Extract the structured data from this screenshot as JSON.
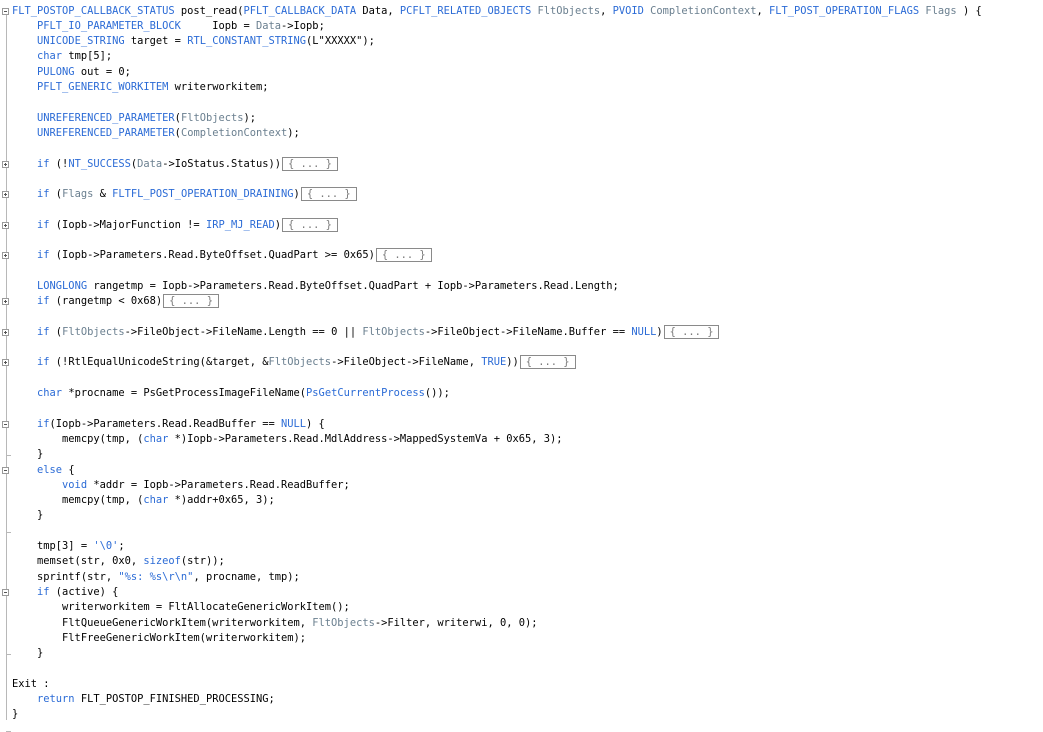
{
  "fold_marker": "{ ... }",
  "lines": [
    [
      [
        "k",
        "FLT_POSTOP_CALLBACK_STATUS"
      ],
      [
        "v",
        " post_read("
      ],
      [
        "k",
        "PFLT_CALLBACK_DATA"
      ],
      [
        "v",
        " Data, "
      ],
      [
        "k",
        "PCFLT_RELATED_OBJECTS"
      ],
      [
        "m",
        " FltObjects"
      ],
      [
        "v",
        ", "
      ],
      [
        "k",
        "PVOID"
      ],
      [
        "m",
        " CompletionContext"
      ],
      [
        "v",
        ", "
      ],
      [
        "k",
        "FLT_POST_OPERATION_FLAGS"
      ],
      [
        "m",
        " Flags"
      ],
      [
        "v",
        " ) {"
      ]
    ],
    [
      [
        "v",
        "    "
      ],
      [
        "k",
        "PFLT_IO_PARAMETER_BLOCK"
      ],
      [
        "v",
        "     Iopb = "
      ],
      [
        "m",
        "Data"
      ],
      [
        "v",
        "->Iopb;"
      ]
    ],
    [
      [
        "v",
        "    "
      ],
      [
        "k",
        "UNICODE_STRING"
      ],
      [
        "v",
        " target = "
      ],
      [
        "k",
        "RTL_CONSTANT_STRING"
      ],
      [
        "v",
        "(L\"XXXXX\");"
      ]
    ],
    [
      [
        "v",
        "    "
      ],
      [
        "k",
        "char"
      ],
      [
        "v",
        " tmp[5];"
      ]
    ],
    [
      [
        "v",
        "    "
      ],
      [
        "k",
        "PULONG"
      ],
      [
        "v",
        " out = 0;"
      ]
    ],
    [
      [
        "v",
        "    "
      ],
      [
        "k",
        "PFLT_GENERIC_WORKITEM"
      ],
      [
        "v",
        " writerworkitem;"
      ]
    ],
    [],
    [
      [
        "v",
        "    "
      ],
      [
        "k",
        "UNREFERENCED_PARAMETER"
      ],
      [
        "v",
        "("
      ],
      [
        "m",
        "FltObjects"
      ],
      [
        "v",
        ");"
      ]
    ],
    [
      [
        "v",
        "    "
      ],
      [
        "k",
        "UNREFERENCED_PARAMETER"
      ],
      [
        "v",
        "("
      ],
      [
        "m",
        "CompletionContext"
      ],
      [
        "v",
        ");"
      ]
    ],
    [],
    [
      [
        "v",
        "    "
      ],
      [
        "k",
        "if"
      ],
      [
        "v",
        " (!"
      ],
      [
        "k",
        "NT_SUCCESS"
      ],
      [
        "v",
        "("
      ],
      [
        "m",
        "Data"
      ],
      [
        "v",
        "->IoStatus.Status))"
      ],
      [
        "f",
        ""
      ]
    ],
    [],
    [
      [
        "v",
        "    "
      ],
      [
        "k",
        "if"
      ],
      [
        "v",
        " ("
      ],
      [
        "m",
        "Flags"
      ],
      [
        "v",
        " & "
      ],
      [
        "k",
        "FLTFL_POST_OPERATION_DRAINING"
      ],
      [
        "v",
        ")"
      ],
      [
        "f",
        ""
      ]
    ],
    [],
    [
      [
        "v",
        "    "
      ],
      [
        "k",
        "if"
      ],
      [
        "v",
        " (Iopb->MajorFunction != "
      ],
      [
        "k",
        "IRP_MJ_READ"
      ],
      [
        "v",
        ")"
      ],
      [
        "f",
        ""
      ]
    ],
    [],
    [
      [
        "v",
        "    "
      ],
      [
        "k",
        "if"
      ],
      [
        "v",
        " (Iopb->Parameters.Read.ByteOffset.QuadPart >= 0x65)"
      ],
      [
        "f",
        ""
      ]
    ],
    [],
    [
      [
        "v",
        "    "
      ],
      [
        "k",
        "LONGLONG"
      ],
      [
        "v",
        " rangetmp = Iopb->Parameters.Read.ByteOffset.QuadPart + Iopb->Parameters.Read.Length;"
      ]
    ],
    [
      [
        "v",
        "    "
      ],
      [
        "k",
        "if"
      ],
      [
        "v",
        " (rangetmp < 0x68)"
      ],
      [
        "f",
        ""
      ]
    ],
    [],
    [
      [
        "v",
        "    "
      ],
      [
        "k",
        "if"
      ],
      [
        "v",
        " ("
      ],
      [
        "m",
        "FltObjects"
      ],
      [
        "v",
        "->FileObject->FileName.Length == 0 || "
      ],
      [
        "m",
        "FltObjects"
      ],
      [
        "v",
        "->FileObject->FileName.Buffer == "
      ],
      [
        "k",
        "NULL"
      ],
      [
        "v",
        ")"
      ],
      [
        "f",
        ""
      ]
    ],
    [],
    [
      [
        "v",
        "    "
      ],
      [
        "k",
        "if"
      ],
      [
        "v",
        " (!RtlEqualUnicodeString(&target, &"
      ],
      [
        "m",
        "FltObjects"
      ],
      [
        "v",
        "->FileObject->FileName, "
      ],
      [
        "k",
        "TRUE"
      ],
      [
        "v",
        "))"
      ],
      [
        "f",
        ""
      ]
    ],
    [],
    [
      [
        "v",
        "    "
      ],
      [
        "k",
        "char"
      ],
      [
        "v",
        " *procname = PsGetProcessImageFileName("
      ],
      [
        "k",
        "PsGetCurrentProcess"
      ],
      [
        "v",
        "());"
      ]
    ],
    [],
    [
      [
        "v",
        "    "
      ],
      [
        "k",
        "if"
      ],
      [
        "v",
        "(Iopb->Parameters.Read.ReadBuffer == "
      ],
      [
        "k",
        "NULL"
      ],
      [
        "v",
        ") {"
      ]
    ],
    [
      [
        "v",
        "        memcpy(tmp, ("
      ],
      [
        "k",
        "char"
      ],
      [
        "v",
        " *)Iopb->Parameters.Read.MdlAddress->MappedSystemVa + 0x65, 3);"
      ]
    ],
    [
      [
        "v",
        "    }"
      ]
    ],
    [
      [
        "v",
        "    "
      ],
      [
        "k",
        "else"
      ],
      [
        "v",
        " {"
      ]
    ],
    [
      [
        "v",
        "        "
      ],
      [
        "k",
        "void"
      ],
      [
        "v",
        " *addr = Iopb->Parameters.Read.ReadBuffer;"
      ]
    ],
    [
      [
        "v",
        "        memcpy(tmp, ("
      ],
      [
        "k",
        "char"
      ],
      [
        "v",
        " *)addr+0x65, 3);"
      ]
    ],
    [
      [
        "v",
        "    }"
      ]
    ],
    [],
    [
      [
        "v",
        "    tmp[3] = "
      ],
      [
        "k",
        "'\\0'"
      ],
      [
        "v",
        ";"
      ]
    ],
    [
      [
        "v",
        "    memset(str, 0x0, "
      ],
      [
        "k",
        "sizeof"
      ],
      [
        "v",
        "(str));"
      ]
    ],
    [
      [
        "v",
        "    sprintf(str, "
      ],
      [
        "k",
        "\"%s: %s\\r\\n\""
      ],
      [
        "v",
        ", procname, tmp);"
      ]
    ],
    [
      [
        "v",
        "    "
      ],
      [
        "k",
        "if"
      ],
      [
        "v",
        " (active) {"
      ]
    ],
    [
      [
        "v",
        "        writerworkitem = FltAllocateGenericWorkItem();"
      ]
    ],
    [
      [
        "v",
        "        FltQueueGenericWorkItem(writerworkitem, "
      ],
      [
        "m",
        "FltObjects"
      ],
      [
        "v",
        "->Filter, writerwi, 0, 0);"
      ]
    ],
    [
      [
        "v",
        "        FltFreeGenericWorkItem(writerworkitem);"
      ]
    ],
    [
      [
        "v",
        "    }"
      ]
    ],
    [],
    [
      [
        "v",
        "Exit :"
      ]
    ],
    [
      [
        "v",
        "    "
      ],
      [
        "k",
        "return"
      ],
      [
        "v",
        " FLT_POSTOP_FINISHED_PROCESSING;"
      ]
    ],
    [
      [
        "v",
        "}"
      ]
    ]
  ],
  "fold_boxes": [
    {
      "line": 0,
      "kind": "minus"
    },
    {
      "line": 10,
      "kind": "plus"
    },
    {
      "line": 12,
      "kind": "plus"
    },
    {
      "line": 14,
      "kind": "plus"
    },
    {
      "line": 16,
      "kind": "plus"
    },
    {
      "line": 19,
      "kind": "plus"
    },
    {
      "line": 21,
      "kind": "plus"
    },
    {
      "line": 23,
      "kind": "plus"
    },
    {
      "line": 27,
      "kind": "minus"
    },
    {
      "line": 30,
      "kind": "minus"
    },
    {
      "line": 38,
      "kind": "minus"
    }
  ],
  "fold_ends": [
    29,
    34,
    42,
    47
  ]
}
